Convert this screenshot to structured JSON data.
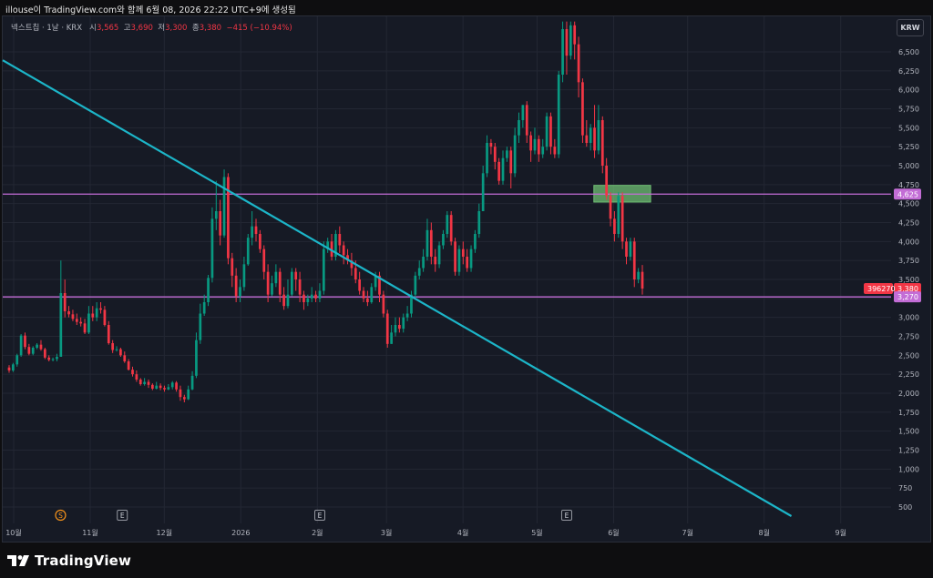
{
  "header": {
    "caption": "illouse이 TradingView.com와 함께 6월 08, 2026 22:22 UTC+9에 생성됨"
  },
  "symbol": {
    "name": "넥스트칩 · 1날 · KRX",
    "open_label": "시",
    "open": "3,565",
    "high_label": "고",
    "high": "3,690",
    "low_label": "저",
    "low": "3,300",
    "close_label": "종",
    "close": "3,380",
    "change": "−415 (−10.94%)"
  },
  "currency_button": "KRW",
  "footer": {
    "brand": "TradingView"
  },
  "colors": {
    "background": "#161a25",
    "up": "#089981",
    "down": "#f23645",
    "trendline": "#1cb5c8",
    "horizontal_line": "#c36dd6",
    "zone_fill": "#6fbf73"
  },
  "chart_data": {
    "type": "candlestick",
    "y_axis": {
      "position": "right",
      "range": [
        380,
        6900
      ],
      "ticks": [
        500,
        750,
        1000,
        1250,
        1500,
        1750,
        2000,
        2250,
        2500,
        2750,
        3000,
        3250,
        3500,
        3750,
        4000,
        4250,
        4500,
        4750,
        5000,
        5250,
        5500,
        5750,
        6000,
        6250,
        6500
      ],
      "tick_labels": [
        "500",
        "750",
        "1,000",
        "1,250",
        "1,500",
        "1,750",
        "2,000",
        "2,250",
        "2,500",
        "2,750",
        "3,000",
        "3,250",
        "3,500",
        "3,750",
        "4,000",
        "4,250",
        "4,500",
        "4,750",
        "5,000",
        "5,250",
        "5,500",
        "5,750",
        "6,000",
        "6,250",
        "6,500"
      ]
    },
    "x_axis": {
      "labels": [
        {
          "text": "10월",
          "date": "2025-10-01"
        },
        {
          "text": "11월",
          "date": "2025-11-01"
        },
        {
          "text": "12월",
          "date": "2025-12-01"
        },
        {
          "text": "2026",
          "date": "2026-01-01"
        },
        {
          "text": "2월",
          "date": "2026-02-01"
        },
        {
          "text": "3월",
          "date": "2026-03-01"
        },
        {
          "text": "4월",
          "date": "2026-04-01"
        },
        {
          "text": "5월",
          "date": "2026-05-01"
        },
        {
          "text": "6월",
          "date": "2026-06-01"
        },
        {
          "text": "7월",
          "date": "2026-07-01"
        },
        {
          "text": "8월",
          "date": "2026-08-01"
        },
        {
          "text": "9월",
          "date": "2026-09-01"
        }
      ]
    },
    "events": [
      {
        "label": "S",
        "date": "2025-10-20",
        "kind": "split"
      },
      {
        "label": "E",
        "date": "2025-11-14",
        "kind": "earnings"
      },
      {
        "label": "E",
        "date": "2026-02-02",
        "kind": "earnings"
      },
      {
        "label": "E",
        "date": "2026-05-13",
        "kind": "earnings"
      }
    ],
    "price_labels": [
      {
        "value": 4625,
        "text": "4,625",
        "color": "#c36dd6"
      },
      {
        "value": 3380,
        "text": "3,380",
        "color": "#f23645",
        "volume": "396270"
      },
      {
        "value": 3270,
        "text": "3,270",
        "color": "#c36dd6"
      }
    ],
    "horizontal_lines": [
      4625,
      3270
    ],
    "trendline": {
      "start": {
        "date": "2025-09-26",
        "price": 6400
      },
      "end": {
        "date": "2026-08-12",
        "price": 380
      }
    },
    "zone": {
      "start": "2026-05-24",
      "end": "2026-06-16",
      "low": 4520,
      "high": 4740
    },
    "candles": [
      [
        2339,
        2300,
        2270,
        2370
      ],
      [
        2300,
        2380,
        2280,
        2400
      ],
      [
        2380,
        2500,
        2350,
        2520
      ],
      [
        2500,
        2760,
        2480,
        2780
      ],
      [
        2760,
        2610,
        2580,
        2800
      ],
      [
        2610,
        2520,
        2500,
        2650
      ],
      [
        2520,
        2600,
        2500,
        2620
      ],
      [
        2600,
        2640,
        2580,
        2660
      ],
      [
        2640,
        2580,
        2560,
        2700
      ],
      [
        2580,
        2470,
        2450,
        2600
      ],
      [
        2470,
        2440,
        2420,
        2500
      ],
      [
        2440,
        2450,
        2420,
        2470
      ],
      [
        2450,
        2480,
        2420,
        2520
      ],
      [
        2480,
        3320,
        2480,
        3750
      ],
      [
        3320,
        3080,
        3000,
        3500
      ],
      [
        3080,
        3040,
        3000,
        3150
      ],
      [
        3040,
        2980,
        2950,
        3100
      ],
      [
        2980,
        2940,
        2900,
        3050
      ],
      [
        2940,
        2920,
        2880,
        3000
      ],
      [
        2920,
        2800,
        2780,
        2980
      ],
      [
        2800,
        3050,
        2780,
        3150
      ],
      [
        3050,
        3000,
        2950,
        3150
      ],
      [
        3000,
        3120,
        2950,
        3200
      ],
      [
        3120,
        3100,
        3050,
        3200
      ],
      [
        3100,
        2900,
        2880,
        3150
      ],
      [
        2900,
        2660,
        2640,
        2950
      ],
      [
        2660,
        2570,
        2530,
        2700
      ],
      [
        2570,
        2580,
        2550,
        2620
      ],
      [
        2580,
        2500,
        2480,
        2600
      ],
      [
        2500,
        2420,
        2400,
        2550
      ],
      [
        2420,
        2310,
        2300,
        2450
      ],
      [
        2310,
        2250,
        2220,
        2350
      ],
      [
        2250,
        2180,
        2150,
        2300
      ],
      [
        2180,
        2120,
        2100,
        2200
      ],
      [
        2120,
        2150,
        2100,
        2200
      ],
      [
        2150,
        2110,
        2070,
        2180
      ],
      [
        2110,
        2060,
        2040,
        2130
      ],
      [
        2060,
        2100,
        2050,
        2150
      ],
      [
        2100,
        2070,
        2040,
        2130
      ],
      [
        2070,
        2050,
        2020,
        2100
      ],
      [
        2050,
        2080,
        2040,
        2120
      ],
      [
        2080,
        2140,
        2050,
        2160
      ],
      [
        2140,
        2050,
        2020,
        2160
      ],
      [
        2050,
        1950,
        1900,
        2100
      ],
      [
        1950,
        1920,
        1880,
        1980
      ],
      [
        1920,
        2050,
        1910,
        2100
      ],
      [
        2050,
        2230,
        2040,
        2290
      ],
      [
        2230,
        2700,
        2200,
        2800
      ],
      [
        2700,
        3050,
        2650,
        3180
      ],
      [
        3050,
        3200,
        3020,
        3300
      ],
      [
        3200,
        3520,
        3150,
        3560
      ],
      [
        3520,
        4300,
        3460,
        4450
      ],
      [
        4300,
        4400,
        4150,
        4800
      ],
      [
        4400,
        4080,
        3950,
        4550
      ],
      [
        4080,
        4850,
        4050,
        4950
      ],
      [
        4850,
        3780,
        3700,
        4900
      ],
      [
        3780,
        3550,
        3400,
        3850
      ],
      [
        3550,
        3280,
        3200,
        3650
      ],
      [
        3280,
        3400,
        3200,
        3500
      ],
      [
        3400,
        3700,
        3350,
        3800
      ],
      [
        3700,
        4050,
        3680,
        4100
      ],
      [
        4050,
        4200,
        3950,
        4400
      ],
      [
        4200,
        4100,
        4000,
        4300
      ],
      [
        4100,
        3900,
        3850,
        4150
      ],
      [
        3900,
        3600,
        3500,
        3950
      ],
      [
        3600,
        3300,
        3200,
        3700
      ],
      [
        3300,
        3450,
        3280,
        3550
      ],
      [
        3450,
        3600,
        3400,
        3700
      ],
      [
        3600,
        3300,
        3200,
        3650
      ],
      [
        3300,
        3150,
        3100,
        3400
      ],
      [
        3150,
        3300,
        3120,
        3500
      ],
      [
        3300,
        3600,
        3280,
        3650
      ],
      [
        3600,
        3500,
        3350,
        3650
      ],
      [
        3500,
        3300,
        3200,
        3600
      ],
      [
        3300,
        3200,
        3100,
        3350
      ],
      [
        3200,
        3250,
        3150,
        3300
      ],
      [
        3250,
        3300,
        3200,
        3400
      ],
      [
        3300,
        3250,
        3200,
        3350
      ],
      [
        3250,
        3350,
        3200,
        3450
      ],
      [
        3350,
        3900,
        3300,
        4000
      ],
      [
        3900,
        4000,
        3850,
        4050
      ],
      [
        4000,
        3800,
        3750,
        4100
      ],
      [
        3800,
        4100,
        3750,
        4150
      ],
      [
        4100,
        3950,
        3850,
        4200
      ],
      [
        3950,
        3820,
        3700,
        4000
      ],
      [
        3820,
        3750,
        3700,
        3900
      ],
      [
        3750,
        3650,
        3550,
        3850
      ],
      [
        3650,
        3500,
        3450,
        3750
      ],
      [
        3500,
        3350,
        3300,
        3600
      ],
      [
        3350,
        3250,
        3200,
        3400
      ],
      [
        3250,
        3200,
        3150,
        3350
      ],
      [
        3200,
        3400,
        3180,
        3450
      ],
      [
        3400,
        3550,
        3350,
        3600
      ],
      [
        3550,
        3300,
        3200,
        3600
      ],
      [
        3300,
        3050,
        3000,
        3350
      ],
      [
        3050,
        2650,
        2600,
        3100
      ],
      [
        2650,
        2800,
        2650,
        2900
      ],
      [
        2800,
        2900,
        2750,
        3000
      ],
      [
        2900,
        2850,
        2800,
        3000
      ],
      [
        2850,
        3000,
        2800,
        3050
      ],
      [
        3000,
        3050,
        2950,
        3150
      ],
      [
        3050,
        3300,
        3000,
        3350
      ],
      [
        3300,
        3550,
        3250,
        3600
      ],
      [
        3550,
        3650,
        3500,
        3750
      ],
      [
        3650,
        3800,
        3600,
        3900
      ],
      [
        3800,
        4150,
        3750,
        4300
      ],
      [
        4150,
        3800,
        3700,
        4250
      ],
      [
        3800,
        3700,
        3600,
        3900
      ],
      [
        3700,
        3950,
        3650,
        4000
      ],
      [
        3950,
        4100,
        3900,
        4150
      ],
      [
        4100,
        4350,
        4050,
        4400
      ],
      [
        4350,
        4000,
        3950,
        4400
      ],
      [
        4000,
        3600,
        3550,
        4050
      ],
      [
        3600,
        3900,
        3550,
        3950
      ],
      [
        3900,
        3800,
        3700,
        4000
      ],
      [
        3800,
        3650,
        3600,
        3900
      ],
      [
        3650,
        3900,
        3600,
        3950
      ],
      [
        3900,
        4100,
        3850,
        4150
      ],
      [
        4100,
        4400,
        4050,
        4500
      ],
      [
        4400,
        4900,
        4400,
        5000
      ],
      [
        4900,
        5300,
        4850,
        5400
      ],
      [
        5300,
        5250,
        5150,
        5350
      ],
      [
        5250,
        5050,
        4950,
        5300
      ],
      [
        5050,
        4800,
        4750,
        5100
      ],
      [
        4800,
        5100,
        4750,
        5200
      ],
      [
        5100,
        5200,
        5050,
        5250
      ],
      [
        5200,
        4900,
        4700,
        5250
      ],
      [
        4900,
        5400,
        4850,
        5500
      ],
      [
        5400,
        5600,
        5300,
        5700
      ],
      [
        5600,
        5800,
        5500,
        5800
      ],
      [
        5800,
        5400,
        5300,
        5850
      ],
      [
        5400,
        5200,
        5050,
        5450
      ],
      [
        5200,
        5350,
        5150,
        5500
      ],
      [
        5350,
        5150,
        5050,
        5400
      ],
      [
        5150,
        5250,
        5100,
        5350
      ],
      [
        5250,
        5650,
        5200,
        5700
      ],
      [
        5650,
        5250,
        5150,
        5700
      ],
      [
        5250,
        5150,
        5100,
        5350
      ],
      [
        5150,
        6200,
        5100,
        6250
      ],
      [
        6200,
        6800,
        6100,
        6900
      ],
      [
        6800,
        6450,
        6200,
        6900
      ],
      [
        6450,
        6850,
        6400,
        6900
      ],
      [
        6850,
        6600,
        6400,
        6900
      ],
      [
        6600,
        6100,
        5900,
        6700
      ],
      [
        6100,
        5400,
        5300,
        6150
      ],
      [
        5400,
        5300,
        5250,
        5600
      ],
      [
        5300,
        5500,
        5200,
        5550
      ],
      [
        5500,
        5200,
        5100,
        5800
      ],
      [
        5200,
        5600,
        5150,
        5800
      ],
      [
        5600,
        5000,
        4900,
        5650
      ],
      [
        5000,
        4600,
        4550,
        5100
      ],
      [
        4600,
        4300,
        4200,
        4650
      ],
      [
        4300,
        4100,
        4000,
        4400
      ],
      [
        4100,
        4600,
        4050,
        4650
      ],
      [
        4600,
        4000,
        3900,
        4650
      ],
      [
        4000,
        3800,
        3700,
        4050
      ],
      [
        3800,
        4000,
        3750,
        4050
      ],
      [
        4000,
        3500,
        3400,
        4050
      ],
      [
        3500,
        3600,
        3450,
        3650
      ],
      [
        3600,
        3380,
        3300,
        3690
      ]
    ]
  }
}
